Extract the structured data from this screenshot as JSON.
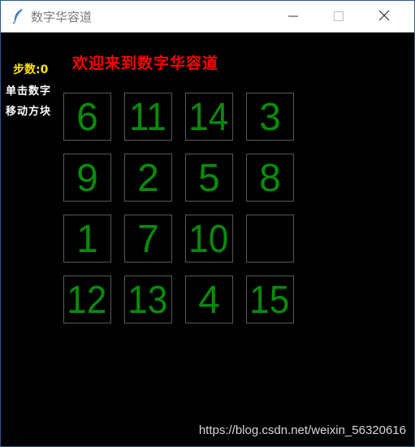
{
  "window": {
    "title": "数字华容道",
    "controls": {
      "minimize": "minimize-icon",
      "maximize": "maximize-icon",
      "close": "close-icon"
    }
  },
  "stats": {
    "steps": "步数:0"
  },
  "hint": {
    "line1": "单击数字",
    "line2": "移动方块"
  },
  "welcome": "欢迎来到数字华容道",
  "board": {
    "tiles": [
      "6",
      "11",
      "14",
      "3",
      "9",
      "2",
      "5",
      "8",
      "1",
      "7",
      "10",
      "",
      "12",
      "13",
      "4",
      "15"
    ]
  },
  "colors": {
    "tile_number": "#0a8a0a",
    "welcome": "#ff0000",
    "steps": "#ffe600",
    "tile_border": "#595959"
  },
  "watermark": "https://blog.csdn.net/weixin_56320616"
}
